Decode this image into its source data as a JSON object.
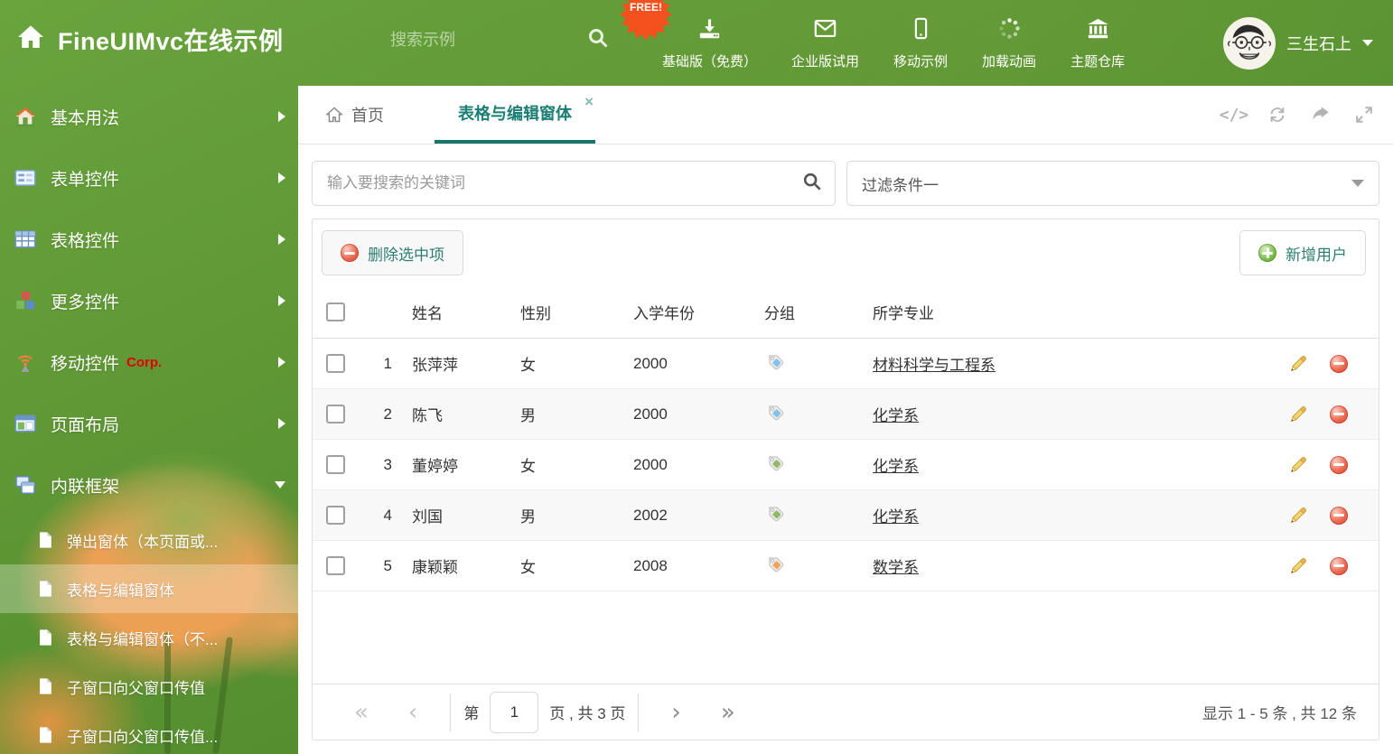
{
  "app": {
    "title": "FineUIMvc在线示例"
  },
  "colors": {
    "accent_teal": "#1b7e74",
    "header_green": "#5d9732",
    "free_badge_orange": "#f4511e",
    "delete_red": "#e05545",
    "add_green": "#6cb33f"
  },
  "header": {
    "search_placeholder": "搜索示例",
    "free_badge": "FREE!",
    "nav": [
      {
        "icon": "download-icon",
        "label": "基础版（免费）"
      },
      {
        "icon": "mail-icon",
        "label": "企业版试用"
      },
      {
        "icon": "mobile-icon",
        "label": "移动示例"
      },
      {
        "icon": "spinner-icon",
        "label": "加载动画"
      },
      {
        "icon": "bank-icon",
        "label": "主题仓库"
      }
    ],
    "user": {
      "name": "三生石上"
    }
  },
  "sidebar": {
    "items": [
      {
        "icon": "home-colored-icon",
        "label": "基本用法",
        "state": "collapsed"
      },
      {
        "icon": "form-icon",
        "label": "表单控件",
        "state": "collapsed"
      },
      {
        "icon": "grid-icon",
        "label": "表格控件",
        "state": "collapsed"
      },
      {
        "icon": "cubes-icon",
        "label": "更多控件",
        "state": "collapsed"
      },
      {
        "icon": "antenna-icon",
        "label": "移动控件",
        "badge": "Corp.",
        "state": "collapsed"
      },
      {
        "icon": "layout-icon",
        "label": "页面布局",
        "state": "collapsed"
      },
      {
        "icon": "frames-icon",
        "label": "内联框架",
        "state": "expanded",
        "children": [
          {
            "label": "弹出窗体（本页面或..."
          },
          {
            "label": "表格与编辑窗体",
            "selected": true
          },
          {
            "label": "表格与编辑窗体（不..."
          },
          {
            "label": "子窗口向父窗口传值"
          },
          {
            "label": "子窗口向父窗口传值..."
          }
        ]
      }
    ]
  },
  "tabs": [
    {
      "label": "首页"
    },
    {
      "label": "表格与编辑窗体",
      "active": true,
      "close": "×"
    }
  ],
  "search": {
    "placeholder": "输入要搜索的关键词"
  },
  "filter": {
    "value": "过滤条件一"
  },
  "toolbar": {
    "delete_button": "删除选中项",
    "add_button": "新增用户"
  },
  "table": {
    "columns": [
      "姓名",
      "性别",
      "入学年份",
      "分组",
      "所学专业"
    ],
    "rows": [
      {
        "num": "1",
        "name": "张萍萍",
        "gender": "女",
        "year": "2000",
        "tag_color": "#85c1ed",
        "major": "材料科学与工程系"
      },
      {
        "num": "2",
        "name": "陈飞",
        "gender": "男",
        "year": "2000",
        "tag_color": "#85c1ed",
        "major": "化学系"
      },
      {
        "num": "3",
        "name": "董婷婷",
        "gender": "女",
        "year": "2000",
        "tag_color": "#8fb964",
        "major": "化学系"
      },
      {
        "num": "4",
        "name": "刘国",
        "gender": "男",
        "year": "2002",
        "tag_color": "#8fb964",
        "major": "化学系"
      },
      {
        "num": "5",
        "name": "康颖颖",
        "gender": "女",
        "year": "2008",
        "tag_color": "#f2a45f",
        "major": "数学系"
      }
    ]
  },
  "pagination": {
    "label_prefix": "第",
    "page": "1",
    "label_suffix": "页 , 共 3 页",
    "summary": "显示 1 - 5 条 , 共 12 条"
  }
}
